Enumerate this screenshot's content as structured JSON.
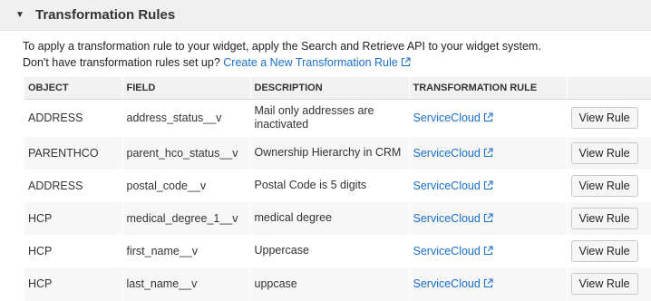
{
  "section": {
    "title": "Transformation Rules"
  },
  "intro": {
    "line1": "To apply a transformation rule to your widget, apply the Search and Retrieve API to your widget system.",
    "line2_prefix": "Don't have transformation rules set up?",
    "create_link": "Create a New Transformation Rule"
  },
  "table": {
    "headers": [
      "OBJECT",
      "FIELD",
      "DESCRIPTION",
      "TRANSFORMATION RULE",
      ""
    ],
    "rows": [
      {
        "object": "ADDRESS",
        "field": "address_status__v",
        "description": "Mail only addresses are inactivated",
        "rule": "ServiceCloud",
        "button": "View Rule"
      },
      {
        "object": "PARENTHCO",
        "field": "parent_hco_status__v",
        "description": "Ownership Hierarchy in CRM",
        "rule": "ServiceCloud",
        "button": "View Rule"
      },
      {
        "object": "ADDRESS",
        "field": "postal_code__v",
        "description": "Postal Code is 5 digits",
        "rule": "ServiceCloud",
        "button": "View Rule"
      },
      {
        "object": "HCP",
        "field": "medical_degree_1__v",
        "description": "medical degree",
        "rule": "ServiceCloud",
        "button": "View Rule"
      },
      {
        "object": "HCP",
        "field": "first_name__v",
        "description": "Uppercase",
        "rule": "ServiceCloud",
        "button": "View Rule"
      },
      {
        "object": "HCP",
        "field": "last_name__v",
        "description": "uppcase",
        "rule": "ServiceCloud",
        "button": "View Rule"
      }
    ]
  },
  "colors": {
    "link": "#1a6fc9",
    "header_bg": "#f0f0f0",
    "row_alt_bg": "#f7f7f7"
  },
  "icons": {
    "collapse": "caret-down-icon",
    "external": "external-link-icon"
  }
}
